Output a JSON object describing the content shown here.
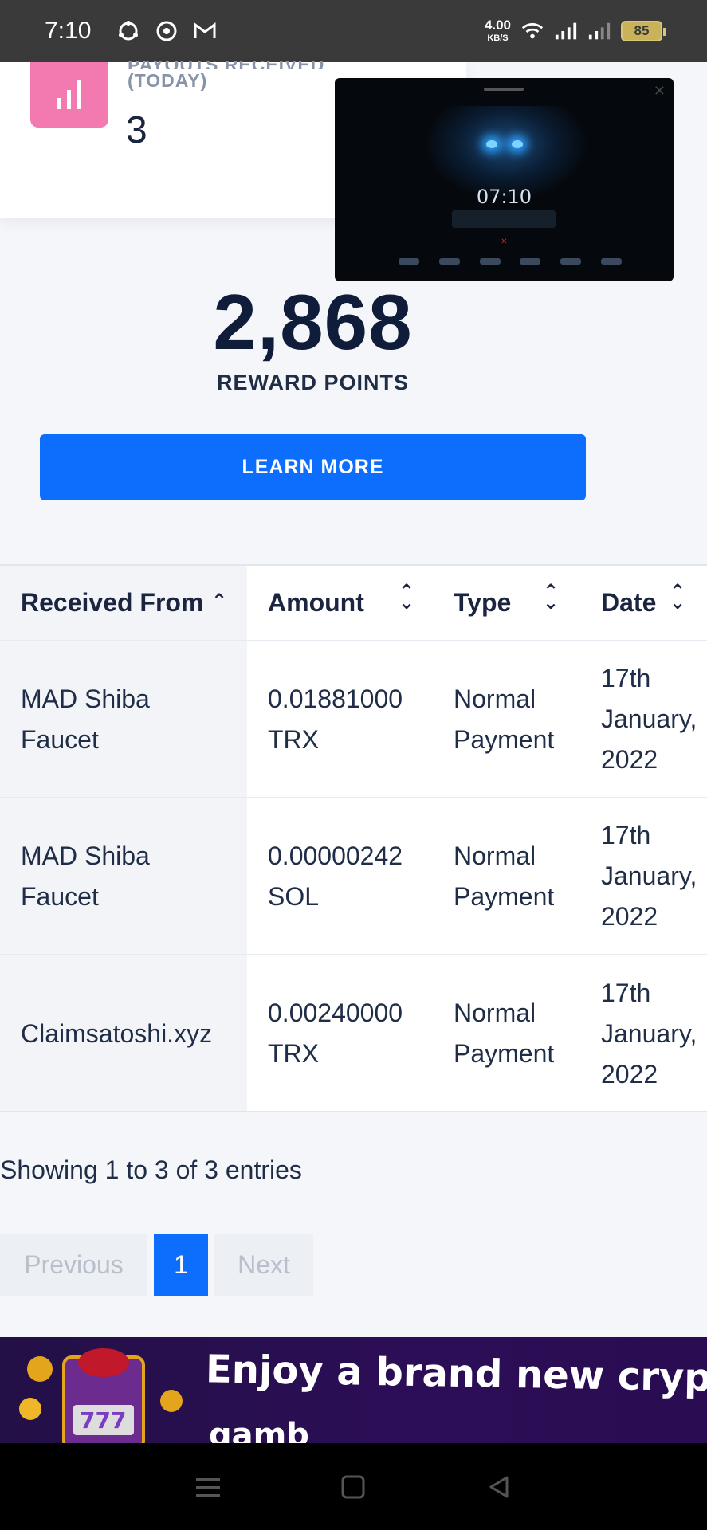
{
  "status_bar": {
    "time": "7:10",
    "net_speed_value": "4.00",
    "net_speed_unit": "KB/S",
    "battery": "85"
  },
  "stat_card": {
    "label_line1": "PAYOUTS RECEIVED",
    "label_line2": "(TODAY)",
    "value": "3"
  },
  "pip": {
    "time": "07:10"
  },
  "reward": {
    "points": "2,868",
    "label": "REWARD POINTS",
    "button": "LEARN MORE"
  },
  "table": {
    "columns": [
      "Received From",
      "Amount",
      "Type",
      "Date"
    ],
    "rows": [
      {
        "from_1": "MAD Shiba",
        "from_2": "Faucet",
        "amount_1": "0.01881000",
        "amount_2": "TRX",
        "type_1": "Normal",
        "type_2": "Payment",
        "date_1": "17th",
        "date_2": "January,",
        "date_3": "2022"
      },
      {
        "from_1": "MAD Shiba",
        "from_2": "Faucet",
        "amount_1": "0.00000242",
        "amount_2": "SOL",
        "type_1": "Normal",
        "type_2": "Payment",
        "date_1": "17th",
        "date_2": "January,",
        "date_3": "2022"
      },
      {
        "from_1": "Claimsatoshi.xyz",
        "from_2": "",
        "amount_1": "0.00240000",
        "amount_2": "TRX",
        "type_1": "Normal",
        "type_2": "Payment",
        "date_1": "17th",
        "date_2": "January,",
        "date_3": "2022"
      }
    ]
  },
  "showing_text": "Showing 1 to 3 of 3 entries",
  "pagination": {
    "previous": "Previous",
    "current_page": "1",
    "next": "Next"
  },
  "banner": {
    "text_line1": "Enjoy a brand new crypt",
    "text_line2": "gamb"
  },
  "colors": {
    "accent": "#0d6efd",
    "stat_icon": "#f27ab0",
    "heading": "#0f1c3a"
  }
}
